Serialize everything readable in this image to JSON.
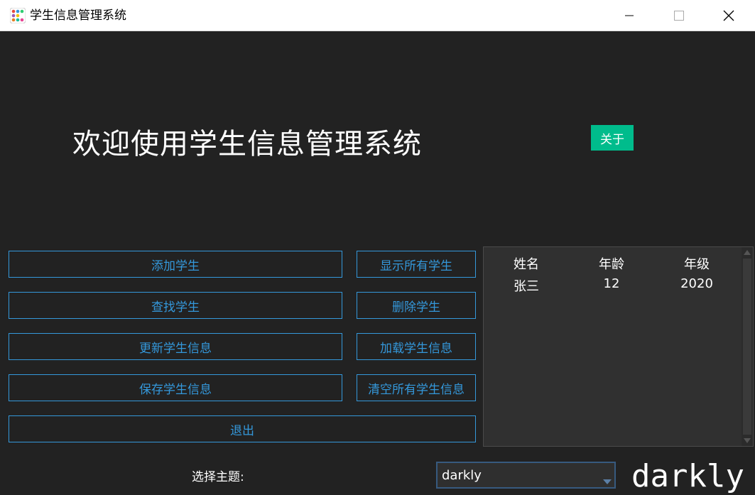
{
  "window": {
    "title": "学生信息管理系统",
    "icon": "app-dots-icon",
    "controls": [
      "minimize-icon",
      "maximize-icon",
      "close-icon"
    ]
  },
  "header": {
    "welcome": "欢迎使用学生信息管理系统",
    "about_label": "关于"
  },
  "actions": {
    "add": "添加学生",
    "show_all": "显示所有学生",
    "find": "查找学生",
    "delete": "删除学生",
    "update": "更新学生信息",
    "load": "加载学生信息",
    "save": "保存学生信息",
    "clear_all": "清空所有学生信息",
    "exit": "退出"
  },
  "table": {
    "columns": [
      "姓名",
      "年龄",
      "年级"
    ],
    "rows": [
      [
        "张三",
        "12",
        "2020"
      ]
    ]
  },
  "theme": {
    "label": "选择主题:",
    "selected": "darkly",
    "display": "darkly"
  },
  "colors": {
    "background": "#222222",
    "accent": "#3498db",
    "success": "#00bc8c",
    "panel": "#303030"
  }
}
